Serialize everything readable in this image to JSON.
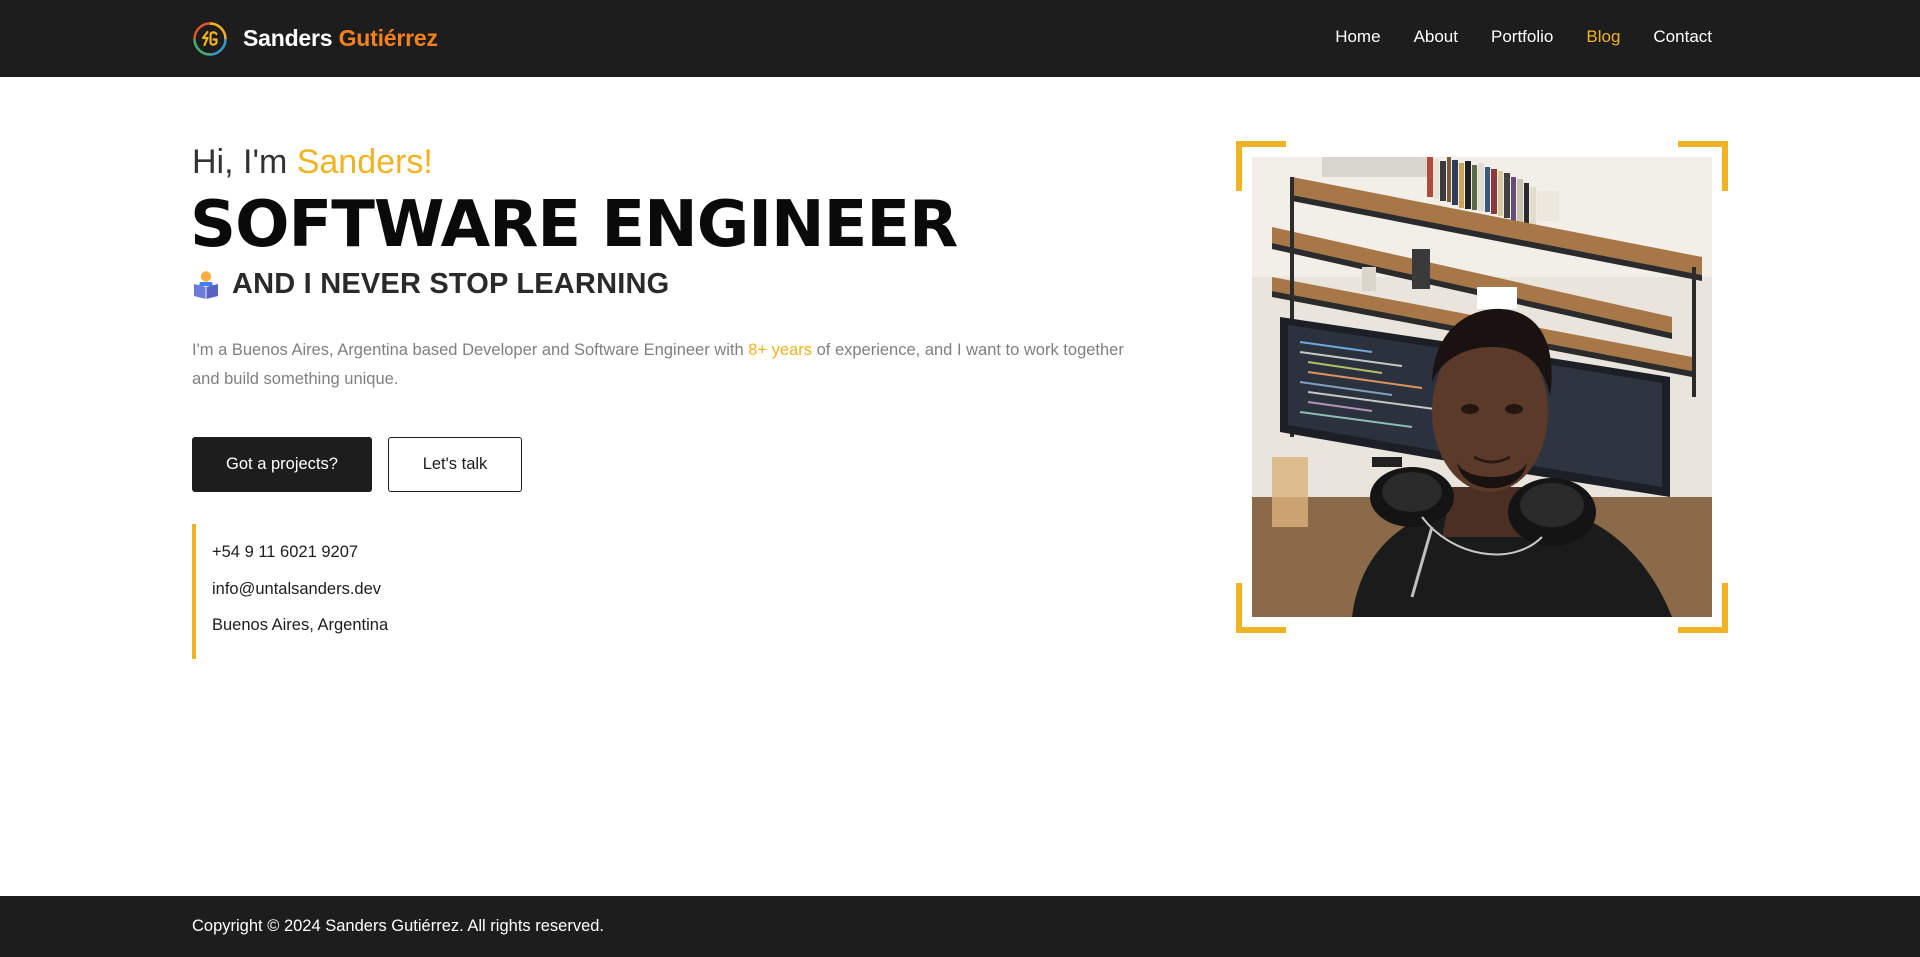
{
  "header": {
    "brand_first": "Sanders",
    "brand_last": "Gutiérrez",
    "nav": [
      {
        "label": "Home"
      },
      {
        "label": "About"
      },
      {
        "label": "Portfolio"
      },
      {
        "label": "Blog",
        "active": true
      },
      {
        "label": "Contact"
      }
    ]
  },
  "hero": {
    "greeting_prefix": "Hi, I'm",
    "greeting_name": "Sanders!",
    "title": "SOFTWARE ENGINEER",
    "subtitle": "AND I NEVER STOP LEARNING",
    "bio_before": "I'm a Buenos Aires, Argentina based Developer and Software Engineer with",
    "bio_highlight": "8+ years",
    "bio_after": "of experience, and I want to work together and build something unique.",
    "primary_button": "Got a projects?",
    "secondary_button": "Let's talk"
  },
  "contact": {
    "phone": "+54 9 11 6021 9207",
    "email": "info@untalsanders.dev",
    "location": "Buenos Aires, Argentina"
  },
  "footer": {
    "copyright": "Copyright © 2024 Sanders Gutiérrez. All rights reserved."
  },
  "colors": {
    "dark": "#1d1d1d",
    "accent_yellow": "#f0b323",
    "accent_orange": "#f5811f",
    "muted_text": "#808080"
  },
  "icons": {
    "logo": "sg-logo-icon",
    "subtitle": "person-reading-icon"
  }
}
